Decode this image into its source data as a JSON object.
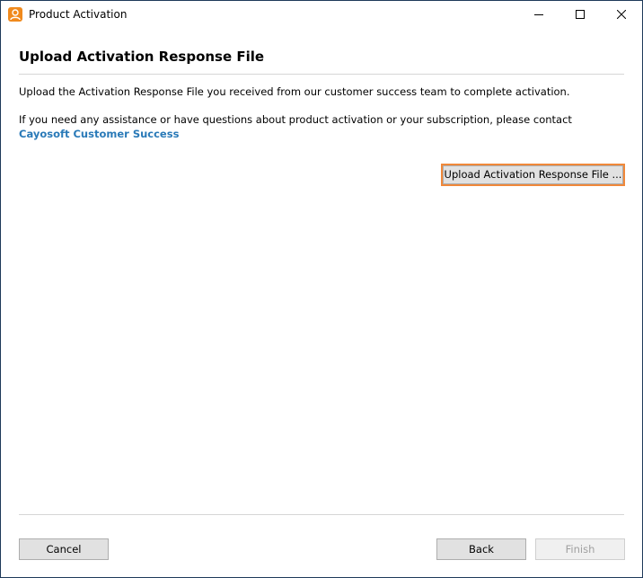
{
  "window": {
    "title": "Product Activation",
    "app_icon": "user-icon",
    "controls": {
      "minimize_icon": "minimize-icon",
      "maximize_icon": "maximize-icon",
      "close_icon": "close-icon"
    }
  },
  "content": {
    "heading": "Upload Activation Response File",
    "paragraph1": "Upload the Activation Response File you received from our customer success team to complete activation.",
    "paragraph2": "If you need any assistance or have questions about product activation or your subscription, please contact",
    "link_text": "Cayosoft Customer Success",
    "upload_button": "Upload Activation Response File ..."
  },
  "footer": {
    "cancel": "Cancel",
    "back": "Back",
    "finish": "Finish",
    "finish_enabled": false
  },
  "colors": {
    "link": "#2a7ab8",
    "focus_outline": "#f0883a",
    "app_icon_bg": "#f08a1d"
  }
}
